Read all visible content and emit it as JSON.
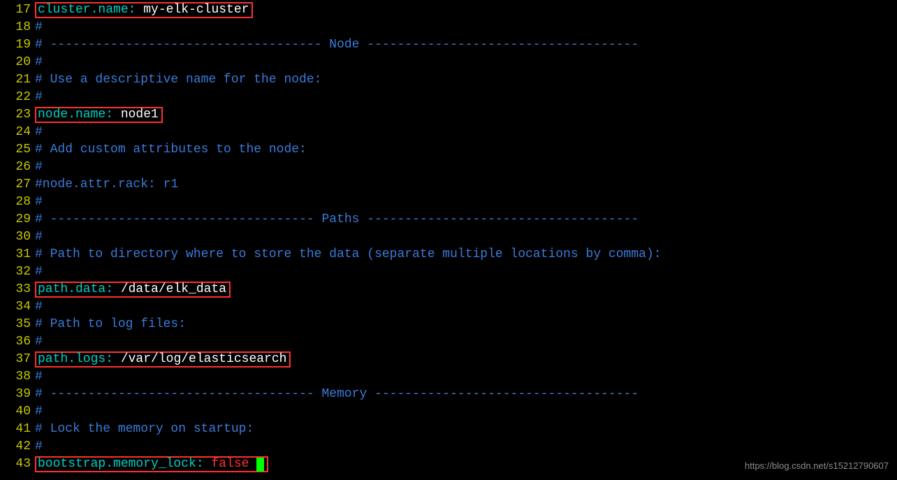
{
  "lines": {
    "l17_key": "cluster.name",
    "l17_val": "my-elk-cluster",
    "l18": "#",
    "l19": "# ------------------------------------ Node ------------------------------------",
    "l20": "#",
    "l21": "# Use a descriptive name for the node:",
    "l22": "#",
    "l23_key": "node.name",
    "l23_val": "node1",
    "l24": "#",
    "l25": "# Add custom attributes to the node:",
    "l26": "#",
    "l27": "#node.attr.rack: r1",
    "l28": "#",
    "l29": "# ----------------------------------- Paths ------------------------------------",
    "l30": "#",
    "l31": "# Path to directory where to store the data (separate multiple locations by comma):",
    "l32": "#",
    "l33_key": "path.data",
    "l33_val": "/data/elk_data",
    "l34": "#",
    "l35": "# Path to log files:",
    "l36": "#",
    "l37_key": "path.logs",
    "l37_val": "/var/log/elasticsearch",
    "l38": "#",
    "l39": "# ----------------------------------- Memory -----------------------------------",
    "l40": "#",
    "l41": "# Lock the memory on startup:",
    "l42": "#",
    "l43_key": "bootstrap.memory_lock",
    "l43_val": "false"
  },
  "numbers": {
    "n17": "17",
    "n18": "18",
    "n19": "19",
    "n20": "20",
    "n21": "21",
    "n22": "22",
    "n23": "23",
    "n24": "24",
    "n25": "25",
    "n26": "26",
    "n27": "27",
    "n28": "28",
    "n29": "29",
    "n30": "30",
    "n31": "31",
    "n32": "32",
    "n33": "33",
    "n34": "34",
    "n35": "35",
    "n36": "36",
    "n37": "37",
    "n38": "38",
    "n39": "39",
    "n40": "40",
    "n41": "41",
    "n42": "42",
    "n43": "43"
  },
  "watermark": "https://blog.csdn.net/s15212790607"
}
